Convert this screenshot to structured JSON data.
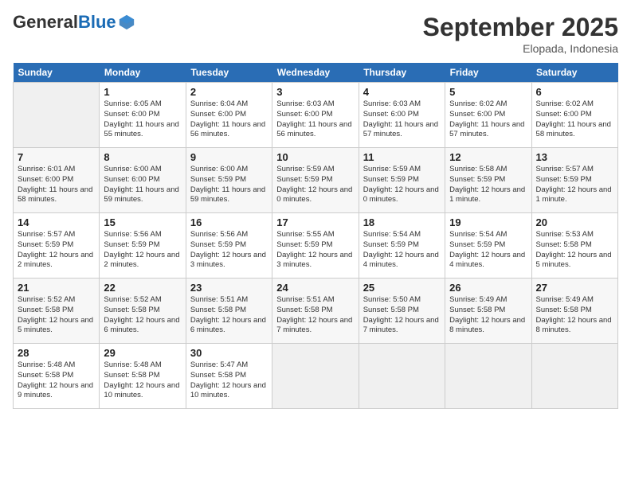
{
  "logo": {
    "general": "General",
    "blue": "Blue"
  },
  "title": "September 2025",
  "subtitle": "Elopada, Indonesia",
  "days_of_week": [
    "Sunday",
    "Monday",
    "Tuesday",
    "Wednesday",
    "Thursday",
    "Friday",
    "Saturday"
  ],
  "weeks": [
    [
      {
        "day": "",
        "empty": true
      },
      {
        "day": "1",
        "sunrise": "Sunrise: 6:05 AM",
        "sunset": "Sunset: 6:00 PM",
        "daylight": "Daylight: 11 hours and 55 minutes."
      },
      {
        "day": "2",
        "sunrise": "Sunrise: 6:04 AM",
        "sunset": "Sunset: 6:00 PM",
        "daylight": "Daylight: 11 hours and 56 minutes."
      },
      {
        "day": "3",
        "sunrise": "Sunrise: 6:03 AM",
        "sunset": "Sunset: 6:00 PM",
        "daylight": "Daylight: 11 hours and 56 minutes."
      },
      {
        "day": "4",
        "sunrise": "Sunrise: 6:03 AM",
        "sunset": "Sunset: 6:00 PM",
        "daylight": "Daylight: 11 hours and 57 minutes."
      },
      {
        "day": "5",
        "sunrise": "Sunrise: 6:02 AM",
        "sunset": "Sunset: 6:00 PM",
        "daylight": "Daylight: 11 hours and 57 minutes."
      },
      {
        "day": "6",
        "sunrise": "Sunrise: 6:02 AM",
        "sunset": "Sunset: 6:00 PM",
        "daylight": "Daylight: 11 hours and 58 minutes."
      }
    ],
    [
      {
        "day": "7",
        "sunrise": "Sunrise: 6:01 AM",
        "sunset": "Sunset: 6:00 PM",
        "daylight": "Daylight: 11 hours and 58 minutes."
      },
      {
        "day": "8",
        "sunrise": "Sunrise: 6:00 AM",
        "sunset": "Sunset: 6:00 PM",
        "daylight": "Daylight: 11 hours and 59 minutes."
      },
      {
        "day": "9",
        "sunrise": "Sunrise: 6:00 AM",
        "sunset": "Sunset: 5:59 PM",
        "daylight": "Daylight: 11 hours and 59 minutes."
      },
      {
        "day": "10",
        "sunrise": "Sunrise: 5:59 AM",
        "sunset": "Sunset: 5:59 PM",
        "daylight": "Daylight: 12 hours and 0 minutes."
      },
      {
        "day": "11",
        "sunrise": "Sunrise: 5:59 AM",
        "sunset": "Sunset: 5:59 PM",
        "daylight": "Daylight: 12 hours and 0 minutes."
      },
      {
        "day": "12",
        "sunrise": "Sunrise: 5:58 AM",
        "sunset": "Sunset: 5:59 PM",
        "daylight": "Daylight: 12 hours and 1 minute."
      },
      {
        "day": "13",
        "sunrise": "Sunrise: 5:57 AM",
        "sunset": "Sunset: 5:59 PM",
        "daylight": "Daylight: 12 hours and 1 minute."
      }
    ],
    [
      {
        "day": "14",
        "sunrise": "Sunrise: 5:57 AM",
        "sunset": "Sunset: 5:59 PM",
        "daylight": "Daylight: 12 hours and 2 minutes."
      },
      {
        "day": "15",
        "sunrise": "Sunrise: 5:56 AM",
        "sunset": "Sunset: 5:59 PM",
        "daylight": "Daylight: 12 hours and 2 minutes."
      },
      {
        "day": "16",
        "sunrise": "Sunrise: 5:56 AM",
        "sunset": "Sunset: 5:59 PM",
        "daylight": "Daylight: 12 hours and 3 minutes."
      },
      {
        "day": "17",
        "sunrise": "Sunrise: 5:55 AM",
        "sunset": "Sunset: 5:59 PM",
        "daylight": "Daylight: 12 hours and 3 minutes."
      },
      {
        "day": "18",
        "sunrise": "Sunrise: 5:54 AM",
        "sunset": "Sunset: 5:59 PM",
        "daylight": "Daylight: 12 hours and 4 minutes."
      },
      {
        "day": "19",
        "sunrise": "Sunrise: 5:54 AM",
        "sunset": "Sunset: 5:59 PM",
        "daylight": "Daylight: 12 hours and 4 minutes."
      },
      {
        "day": "20",
        "sunrise": "Sunrise: 5:53 AM",
        "sunset": "Sunset: 5:58 PM",
        "daylight": "Daylight: 12 hours and 5 minutes."
      }
    ],
    [
      {
        "day": "21",
        "sunrise": "Sunrise: 5:52 AM",
        "sunset": "Sunset: 5:58 PM",
        "daylight": "Daylight: 12 hours and 5 minutes."
      },
      {
        "day": "22",
        "sunrise": "Sunrise: 5:52 AM",
        "sunset": "Sunset: 5:58 PM",
        "daylight": "Daylight: 12 hours and 6 minutes."
      },
      {
        "day": "23",
        "sunrise": "Sunrise: 5:51 AM",
        "sunset": "Sunset: 5:58 PM",
        "daylight": "Daylight: 12 hours and 6 minutes."
      },
      {
        "day": "24",
        "sunrise": "Sunrise: 5:51 AM",
        "sunset": "Sunset: 5:58 PM",
        "daylight": "Daylight: 12 hours and 7 minutes."
      },
      {
        "day": "25",
        "sunrise": "Sunrise: 5:50 AM",
        "sunset": "Sunset: 5:58 PM",
        "daylight": "Daylight: 12 hours and 7 minutes."
      },
      {
        "day": "26",
        "sunrise": "Sunrise: 5:49 AM",
        "sunset": "Sunset: 5:58 PM",
        "daylight": "Daylight: 12 hours and 8 minutes."
      },
      {
        "day": "27",
        "sunrise": "Sunrise: 5:49 AM",
        "sunset": "Sunset: 5:58 PM",
        "daylight": "Daylight: 12 hours and 8 minutes."
      }
    ],
    [
      {
        "day": "28",
        "sunrise": "Sunrise: 5:48 AM",
        "sunset": "Sunset: 5:58 PM",
        "daylight": "Daylight: 12 hours and 9 minutes."
      },
      {
        "day": "29",
        "sunrise": "Sunrise: 5:48 AM",
        "sunset": "Sunset: 5:58 PM",
        "daylight": "Daylight: 12 hours and 10 minutes."
      },
      {
        "day": "30",
        "sunrise": "Sunrise: 5:47 AM",
        "sunset": "Sunset: 5:58 PM",
        "daylight": "Daylight: 12 hours and 10 minutes."
      },
      {
        "day": "",
        "empty": true
      },
      {
        "day": "",
        "empty": true
      },
      {
        "day": "",
        "empty": true
      },
      {
        "day": "",
        "empty": true
      }
    ]
  ]
}
